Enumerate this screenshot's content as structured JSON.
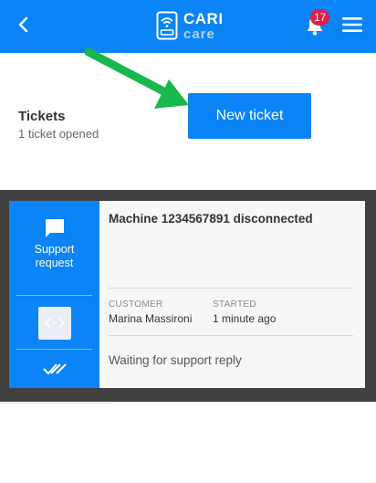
{
  "header": {
    "logo_top": "CARI",
    "logo_bottom": "care",
    "notification_count": "17",
    "brand_color": "#0a84f6",
    "badge_color": "#e11c4b"
  },
  "tickets": {
    "title": "Tickets",
    "subtitle": "1 ticket opened",
    "new_button_label": "New ticket"
  },
  "ticket": {
    "title": "Machine 1234567891 disconnected",
    "side_label_line1": "Support",
    "side_label_line2": "request",
    "customer_label": "CUSTOMER",
    "customer_value": "Marina Massironi",
    "started_label": "STARTED",
    "started_value": "1 minute ago",
    "status": "Waiting for support reply"
  },
  "icons": {
    "back": "chevron-left-icon",
    "logo": "wifi-ticket-icon",
    "bell": "bell-icon",
    "menu": "hamburger-menu-icon",
    "chat": "chat-bubble-icon",
    "code": "code-icon",
    "checks": "double-check-icon",
    "annotation": "green-arrow-icon"
  }
}
